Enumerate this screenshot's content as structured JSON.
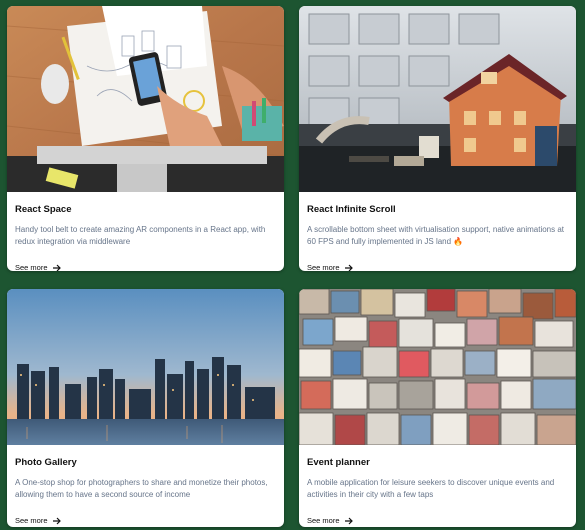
{
  "cards": [
    {
      "title": "React Space",
      "description": "Handy tool belt to create amazing AR components in a React app, with redux integration via middleware",
      "link_label": "See more",
      "image_icon": "desk-workspace-photo"
    },
    {
      "title": "React Infinite Scroll",
      "description": "A scrollable bottom sheet with virtualisation support, native animations at 60 FPS and fully implemented in JS land 🔥",
      "link_label": "See more",
      "image_icon": "toy-house-photo"
    },
    {
      "title": "Photo Gallery",
      "description": "A One-stop shop for photographers to share and monetize their photos, allowing them to have a second source of income",
      "link_label": "See more",
      "image_icon": "city-skyline-photo"
    },
    {
      "title": "Event planner",
      "description": "A mobile application for leisure seekers to discover unique events and activities in their city with a few taps",
      "link_label": "See more",
      "image_icon": "colored-stones-photo"
    }
  ],
  "colors": {
    "page_background": "#1d5531",
    "card_background": "#ffffff",
    "title_text": "#111111",
    "description_text": "#67758a"
  }
}
